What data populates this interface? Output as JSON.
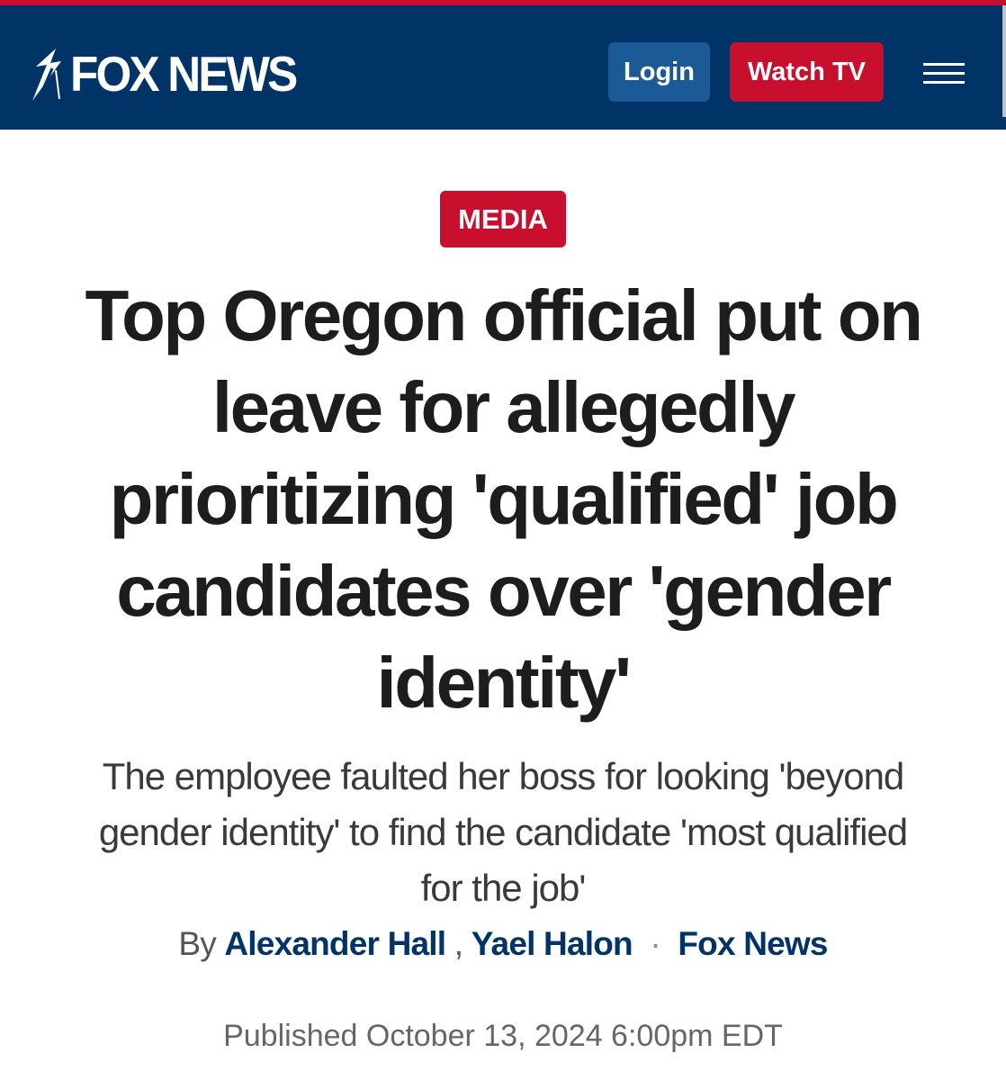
{
  "header": {
    "logo_text": "FOX NEWS",
    "login_label": "Login",
    "watch_tv_label": "Watch TV"
  },
  "article": {
    "category": "MEDIA",
    "headline": "Top Oregon official put on leave for allegedly prioritizing 'qualified' job candidates over 'gender identity'",
    "subheadline": "The employee faulted her boss for looking 'beyond gender identity' to find the candidate 'most qualified for the job'",
    "byline": {
      "by": "By",
      "authors": [
        "Alexander Hall",
        "Yael Halon"
      ],
      "author_separator": ",",
      "dot": "·",
      "source": "Fox News"
    },
    "published": "Published October 13, 2024 6:00pm EDT"
  },
  "colors": {
    "header_background": "#003366",
    "brand_red": "#c8102e",
    "login_button": "#1c5a96",
    "link_blue": "#003366"
  },
  "icons": {
    "menu": "hamburger-menu-icon",
    "logo_mark": "fox-news-lightning-mark"
  }
}
